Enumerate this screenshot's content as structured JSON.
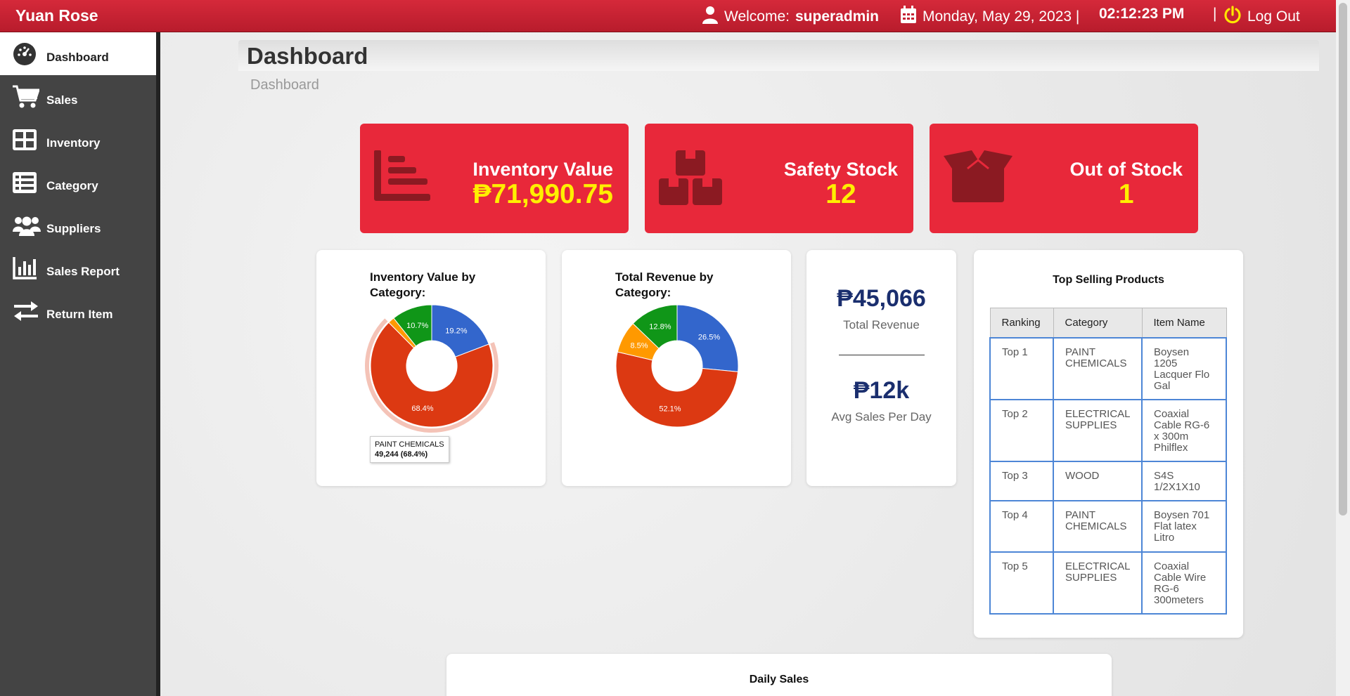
{
  "app": {
    "brand": "Yuan Rose",
    "welcome_label": "Welcome:",
    "username": "superadmin",
    "date": "Monday, May 29, 2023 |",
    "time": "02:12:23 PM",
    "separator": "|",
    "logout_label": "Log Out"
  },
  "sidebar": {
    "items": [
      {
        "label": "Dashboard",
        "icon": "dashboard-gauge-icon",
        "active": true
      },
      {
        "label": "Sales",
        "icon": "cart-icon"
      },
      {
        "label": "Inventory",
        "icon": "inventory-grid-icon"
      },
      {
        "label": "Category",
        "icon": "list-icon"
      },
      {
        "label": "Suppliers",
        "icon": "users-icon"
      },
      {
        "label": "Sales Report",
        "icon": "bar-chart-icon"
      },
      {
        "label": "Return Item",
        "icon": "exchange-arrows-icon"
      }
    ]
  },
  "page": {
    "title": "Dashboard",
    "breadcrumb": "Dashboard"
  },
  "stats": [
    {
      "label": "Inventory Value",
      "value": "₱71,990.75",
      "icon": "list-bars-icon"
    },
    {
      "label": "Safety Stock",
      "value": "12",
      "icon": "boxes-icon"
    },
    {
      "label": "Out of Stock",
      "value": "1",
      "icon": "open-box-icon"
    }
  ],
  "revenue": {
    "total_value": "₱45,066",
    "total_label": "Total Revenue",
    "avg_value": "₱12k",
    "avg_label": "Avg Sales Per Day"
  },
  "top_selling": {
    "title": "Top Selling Products",
    "columns": [
      "Ranking",
      "Category",
      "Item Name"
    ],
    "rows": [
      [
        "Top 1",
        "PAINT CHEMICALS",
        "Boysen 1205 Lacquer Flo Gal"
      ],
      [
        "Top 2",
        "ELECTRICAL SUPPLIES",
        "Coaxial Cable RG-6 x 300m Philflex"
      ],
      [
        "Top 3",
        "WOOD",
        "S4S 1/2X1X10"
      ],
      [
        "Top 4",
        "PAINT CHEMICALS",
        "Boysen 701 Flat latex Litro"
      ],
      [
        "Top 5",
        "ELECTRICAL SUPPLIES",
        "Coaxial Cable Wire RG-6 300meters"
      ]
    ]
  },
  "tooltip": {
    "category": "PAINT CHEMICALS",
    "value": "49,244 (68.4%)"
  },
  "daily_sales": {
    "title": "Daily Sales"
  },
  "chart_data": [
    {
      "type": "pie",
      "title": "Inventory Value by Category:",
      "slices": [
        {
          "value": 19.2,
          "color": "#3366cc",
          "label": "19.2%"
        },
        {
          "value": 68.4,
          "color": "#dc3912",
          "label": "68.4%"
        },
        {
          "value": 1.7,
          "color": "#ff9900",
          "label": ""
        },
        {
          "value": 10.7,
          "color": "#109618",
          "label": "10.7%"
        }
      ]
    },
    {
      "type": "pie",
      "title": "Total Revenue by Category:",
      "slices": [
        {
          "value": 26.5,
          "color": "#3366cc",
          "label": "26.5%"
        },
        {
          "value": 52.1,
          "color": "#dc3912",
          "label": "52.1%"
        },
        {
          "value": 8.5,
          "color": "#ff9900",
          "label": "8.5%"
        },
        {
          "value": 12.8,
          "color": "#109618",
          "label": "12.8%"
        }
      ]
    }
  ]
}
